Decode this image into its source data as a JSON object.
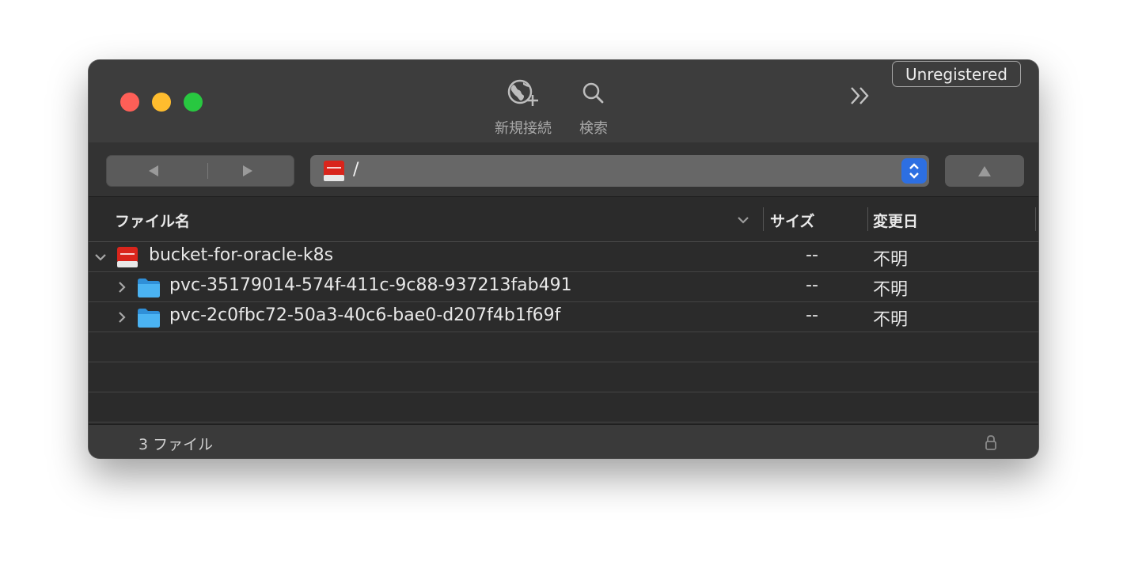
{
  "window": {
    "badge": "Unregistered"
  },
  "toolbar": {
    "new_connection_label": "新規接続",
    "search_label": "検索"
  },
  "nav": {
    "path": "/"
  },
  "columns": {
    "name": "ファイル名",
    "size": "サイズ",
    "modified": "変更日"
  },
  "rows": [
    {
      "name": "bucket-for-oracle-k8s",
      "size": "--",
      "modified": "不明",
      "expanded": true,
      "icon": "oracle-bucket-icon"
    },
    {
      "name": "pvc-35179014-574f-411c-9c88-937213fab491",
      "size": "--",
      "modified": "不明",
      "expanded": false,
      "icon": "folder-icon"
    },
    {
      "name": "pvc-2c0fbc72-50a3-40c6-bae0-d207f4b1f69f",
      "size": "--",
      "modified": "不明",
      "expanded": false,
      "icon": "folder-icon"
    }
  ],
  "status": {
    "count": "3 ファイル"
  },
  "colors": {
    "close": "#fe5f57",
    "minimize": "#febc2e",
    "maximize": "#28c840",
    "accent": "#2d6fe2",
    "folder": "#3aa6ec",
    "oracle_red": "#d9251c"
  }
}
